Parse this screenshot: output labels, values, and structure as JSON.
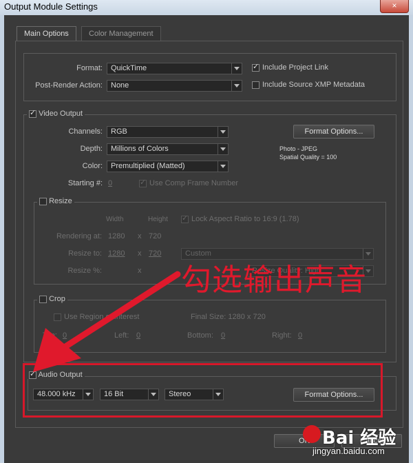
{
  "window": {
    "title": "Output Module Settings",
    "close_glyph": "×"
  },
  "tabs": [
    {
      "label": "Main Options"
    },
    {
      "label": "Color Management"
    }
  ],
  "top": {
    "format_label": "Format:",
    "format_value": "QuickTime",
    "post_render_label": "Post-Render Action:",
    "post_render_value": "None",
    "include_project_link": "Include Project Link",
    "include_xmp": "Include Source XMP Metadata"
  },
  "video": {
    "title": "Video Output",
    "channels_label": "Channels:",
    "channels_value": "RGB",
    "depth_label": "Depth:",
    "depth_value": "Millions of Colors",
    "color_label": "Color:",
    "color_value": "Premultiplied (Matted)",
    "starting_label": "Starting #:",
    "starting_value": "0",
    "use_comp_frame": "Use Comp Frame Number",
    "format_options": "Format Options...",
    "info_line1": "Photo - JPEG",
    "info_line2": "Spatial Quality = 100"
  },
  "resize": {
    "title": "Resize",
    "width_label": "Width",
    "height_label": "Height",
    "lock_aspect": "Lock Aspect Ratio to 16:9 (1.78)",
    "rendering_at_label": "Rendering at:",
    "rendering_w": "1280",
    "rendering_x": "x",
    "rendering_h": "720",
    "resize_to_label": "Resize to:",
    "resize_w": "1280",
    "resize_x": "x",
    "resize_h": "720",
    "preset_value": "Custom",
    "resize_pct_label": "Resize %:",
    "resize_pct_x": "x",
    "quality_value": "Resize Quality: High"
  },
  "crop": {
    "title": "Crop",
    "use_roi": "Use Region of Interest",
    "final_size": "Final Size: 1280 x 720",
    "top_label": "Top:",
    "top_value": "0",
    "left_label": "Left:",
    "left_value": "0",
    "bottom_label": "Bottom:",
    "bottom_value": "0",
    "right_label": "Right:",
    "right_value": "0"
  },
  "audio": {
    "title": "Audio Output",
    "rate_value": "48.000 kHz",
    "bits_value": "16 Bit",
    "channels_value": "Stereo",
    "format_options": "Format Options..."
  },
  "footer": {
    "ok": "OK",
    "cancel": "Cancel"
  },
  "annotation": {
    "text": "勾选输出声音",
    "color": "#e0192c"
  },
  "watermark": {
    "main": "Bai 经验",
    "sub": "jingyan.baidu.com"
  }
}
